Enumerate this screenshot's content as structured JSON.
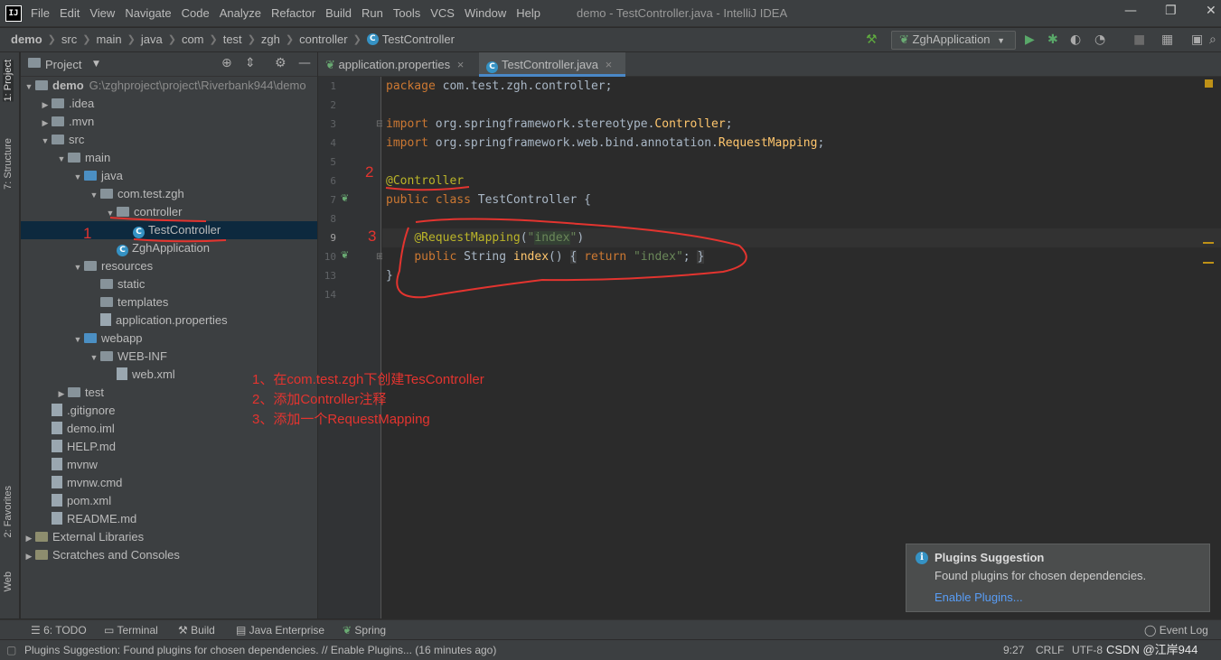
{
  "menubar": {
    "items": [
      "File",
      "Edit",
      "View",
      "Navigate",
      "Code",
      "Analyze",
      "Refactor",
      "Build",
      "Run",
      "Tools",
      "VCS",
      "Window",
      "Help"
    ],
    "window_title": "demo - TestController.java - IntelliJ IDEA"
  },
  "navbar": {
    "breadcrumbs": [
      "demo",
      "src",
      "main",
      "java",
      "com",
      "test",
      "zgh",
      "controller",
      "TestController"
    ],
    "run_config": "ZghApplication"
  },
  "sidebar_tabs": {
    "project": "1: Project",
    "structure": "7: Structure",
    "favorites": "2: Favorites",
    "web": "Web"
  },
  "project": {
    "header": "Project",
    "tree": [
      {
        "label": "demo",
        "extra": "G:\\zghproject\\project\\Riverbank944\\demo",
        "depth": 0,
        "arrow": "▼",
        "kind": "folder"
      },
      {
        "label": ".idea",
        "depth": 1,
        "arrow": "▶",
        "kind": "folder"
      },
      {
        "label": ".mvn",
        "depth": 1,
        "arrow": "▶",
        "kind": "folder"
      },
      {
        "label": "src",
        "depth": 1,
        "arrow": "▼",
        "kind": "folder"
      },
      {
        "label": "main",
        "depth": 2,
        "arrow": "▼",
        "kind": "folder"
      },
      {
        "label": "java",
        "depth": 3,
        "arrow": "▼",
        "kind": "blue"
      },
      {
        "label": "com.test.zgh",
        "depth": 4,
        "arrow": "▼",
        "kind": "pkg"
      },
      {
        "label": "controller",
        "depth": 5,
        "arrow": "▼",
        "kind": "pkg"
      },
      {
        "label": "TestController",
        "depth": 6,
        "arrow": "",
        "kind": "class",
        "selected": true
      },
      {
        "label": "ZghApplication",
        "depth": 5,
        "arrow": "",
        "kind": "class"
      },
      {
        "label": "resources",
        "depth": 3,
        "arrow": "▼",
        "kind": "folder"
      },
      {
        "label": "static",
        "depth": 4,
        "arrow": "",
        "kind": "folder"
      },
      {
        "label": "templates",
        "depth": 4,
        "arrow": "",
        "kind": "folder"
      },
      {
        "label": "application.properties",
        "depth": 4,
        "arrow": "",
        "kind": "file"
      },
      {
        "label": "webapp",
        "depth": 3,
        "arrow": "▼",
        "kind": "blue"
      },
      {
        "label": "WEB-INF",
        "depth": 4,
        "arrow": "▼",
        "kind": "folder"
      },
      {
        "label": "web.xml",
        "depth": 5,
        "arrow": "",
        "kind": "file"
      },
      {
        "label": "test",
        "depth": 2,
        "arrow": "▶",
        "kind": "folder"
      },
      {
        "label": ".gitignore",
        "depth": 1,
        "arrow": "",
        "kind": "file"
      },
      {
        "label": "demo.iml",
        "depth": 1,
        "arrow": "",
        "kind": "file"
      },
      {
        "label": "HELP.md",
        "depth": 1,
        "arrow": "",
        "kind": "file"
      },
      {
        "label": "mvnw",
        "depth": 1,
        "arrow": "",
        "kind": "file"
      },
      {
        "label": "mvnw.cmd",
        "depth": 1,
        "arrow": "",
        "kind": "file"
      },
      {
        "label": "pom.xml",
        "depth": 1,
        "arrow": "",
        "kind": "file"
      },
      {
        "label": "README.md",
        "depth": 1,
        "arrow": "",
        "kind": "file"
      },
      {
        "label": "External Libraries",
        "depth": 0,
        "arrow": "▶",
        "kind": "lib"
      },
      {
        "label": "Scratches and Consoles",
        "depth": 0,
        "arrow": "▶",
        "kind": "lib"
      }
    ]
  },
  "editor": {
    "tabs": [
      {
        "label": "application.properties",
        "active": false
      },
      {
        "label": "TestController.java",
        "active": true
      }
    ],
    "line_numbers": [
      "1",
      "2",
      "3",
      "4",
      "5",
      "6",
      "7",
      "8",
      "9",
      "10",
      "13",
      "14"
    ]
  },
  "annotations": {
    "marker1": "1",
    "marker2": "2",
    "marker3": "3",
    "note_line1": "1、在com.test.zgh下创建TesController",
    "note_line2": "2、添加Controller注释",
    "note_line3": "3、添加一个RequestMapping"
  },
  "popup": {
    "title": "Plugins Suggestion",
    "body": "Found plugins for chosen dependencies.",
    "link": "Enable Plugins..."
  },
  "toolbar_bottom": {
    "todo": "6: TODO",
    "terminal": "Terminal",
    "build": "Build",
    "java_enterprise": "Java Enterprise",
    "spring": "Spring",
    "event_log": "Event Log"
  },
  "status": {
    "message": "Plugins Suggestion: Found plugins for chosen dependencies. // Enable Plugins... (16 minutes ago)",
    "position": "9:27",
    "line_sep": "CRLF",
    "encoding": "UTF-8",
    "watermark": "CSDN @江岸944"
  }
}
